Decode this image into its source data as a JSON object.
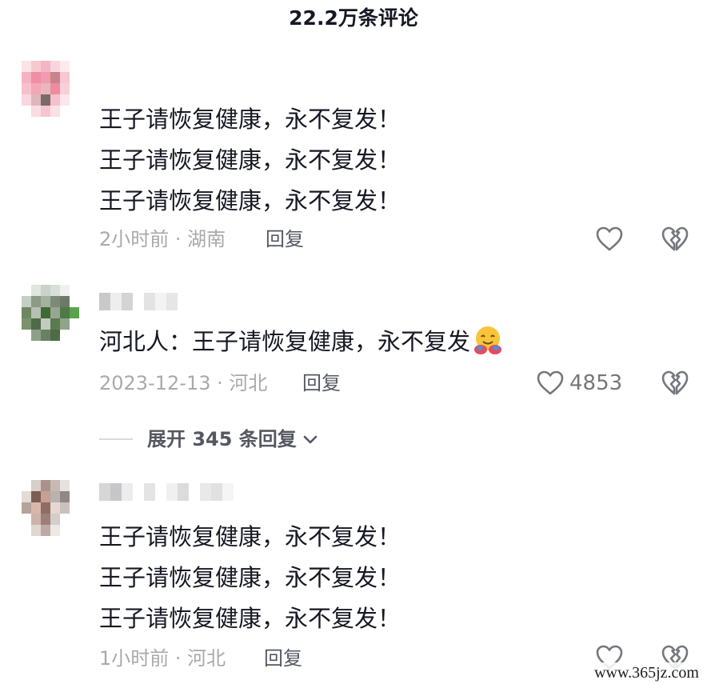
{
  "header": {
    "title": "22.2万条评论"
  },
  "comments": [
    {
      "lines": [
        "王子请恢复健康，永不复发！",
        " 王子请恢复健康，永不复发！",
        " 王子请恢复健康，永不复发！"
      ],
      "meta": "2小时前 · 湖南",
      "reply_label": "回复",
      "like_count": ""
    },
    {
      "lines": [
        "河北人：王子请恢复健康，永不复发"
      ],
      "emoji": "hugging-face-emoji",
      "meta": "2023-12-13 · 河北",
      "reply_label": "回复",
      "like_count": "4853"
    },
    {
      "lines": [
        "王子请恢复健康，永不复发！",
        " 王子请恢复健康，永不复发！",
        " 王子请恢复健康，永不复发！"
      ],
      "meta": "1小时前 · 河北",
      "reply_label": "回复",
      "like_count": ""
    }
  ],
  "expand_replies": {
    "label": "展开 345 条回复"
  },
  "watermark": "www.365jz.com",
  "icons": {
    "like": "heart-outline-icon",
    "dislike": "broken-heart-icon",
    "chevron": "chevron-down-icon"
  },
  "colors": {
    "text": "#161823",
    "meta": "#a8a9ad",
    "action": "#555761"
  }
}
